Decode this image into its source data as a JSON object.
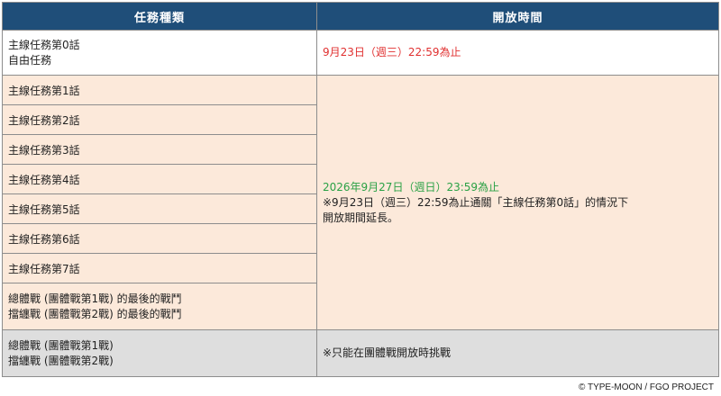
{
  "table": {
    "headers": [
      "任務種類",
      "開放時間"
    ],
    "row0": {
      "types": [
        "主線任務第0話",
        "自由任務"
      ],
      "time": "9月23日（週三）22:59為止"
    },
    "peach_rows": [
      "主線任務第1話",
      "主線任務第2話",
      "主線任務第3話",
      "主線任務第4話",
      "主線任務第5話",
      "主線任務第6話",
      "主線任務第7話"
    ],
    "peach_last": [
      "總體戰 (團體戰第1戰) 的最後的戰鬥",
      "擋纏戰 (團體戰第2戰) 的最後的戰鬥"
    ],
    "peach_time": {
      "date": "2026年9月27日（週日）23:59為止",
      "note": [
        "※9月23日（週三）22:59為止通關「主線任務第0話」的情況下",
        "開放期間延長。"
      ]
    },
    "grey_row": {
      "types": [
        "總體戰 (團體戰第1戰)",
        "擋纏戰 (團體戰第2戰)"
      ],
      "time": "※只能在團體戰開放時挑戰"
    }
  },
  "copyright": "© TYPE-MOON / FGO PROJECT",
  "colors": {
    "header_bg": "#1f4e79",
    "peach_bg": "#fce9da",
    "grey_bg": "#dedede",
    "red_text": "#e03030",
    "green_text": "#2aa145"
  }
}
